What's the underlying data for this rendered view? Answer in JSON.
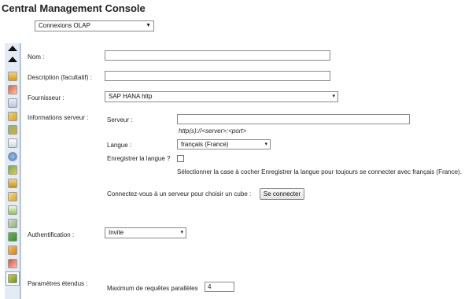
{
  "app_title": "Central Management Console",
  "category_select": {
    "value": "Connexions OLAP",
    "arrow": "▼"
  },
  "sidebar": {
    "icons": [
      "scroll-up-icon",
      "scroll-up-icon",
      "folder-icon",
      "tools-icon",
      "calendar-icon",
      "properties-icon",
      "users-icon",
      "document-icon",
      "info-icon",
      "user-group-icon",
      "lock-icon",
      "key-icon",
      "report-icon",
      "settings-icon",
      "network-icon",
      "stamp-icon",
      "pin-icon",
      "connection-icon"
    ]
  },
  "form": {
    "nom_label": "Nom :",
    "nom_value": "",
    "description_label": "Description (facultatif) :",
    "description_value": "",
    "fournisseur_label": "Fournisseur :",
    "fournisseur_value": "SAP HANA http",
    "infos_label": "Informations serveur :",
    "serveur_label": "Serveur :",
    "serveur_value": "",
    "serveur_hint": "http(s)://<server>:<port>",
    "langue_label": "Langue :",
    "langue_value": "français (France)",
    "enregistrer_label": "Enregistrer la langue ?",
    "enregistrer_hint": "Sélectionner la case à cocher Enregistrer la langue pour toujours se connecter avec français (France).",
    "connect_prompt": "Connectez-vous à un serveur pour choisir un cube :",
    "connect_button": "Se connecter",
    "auth_label": "Authentification :",
    "auth_value": "Invite",
    "params_label": "Paramètres étendus :",
    "max_requests_label": "Maximum de requêtes parallèles",
    "max_requests_value": "4"
  }
}
